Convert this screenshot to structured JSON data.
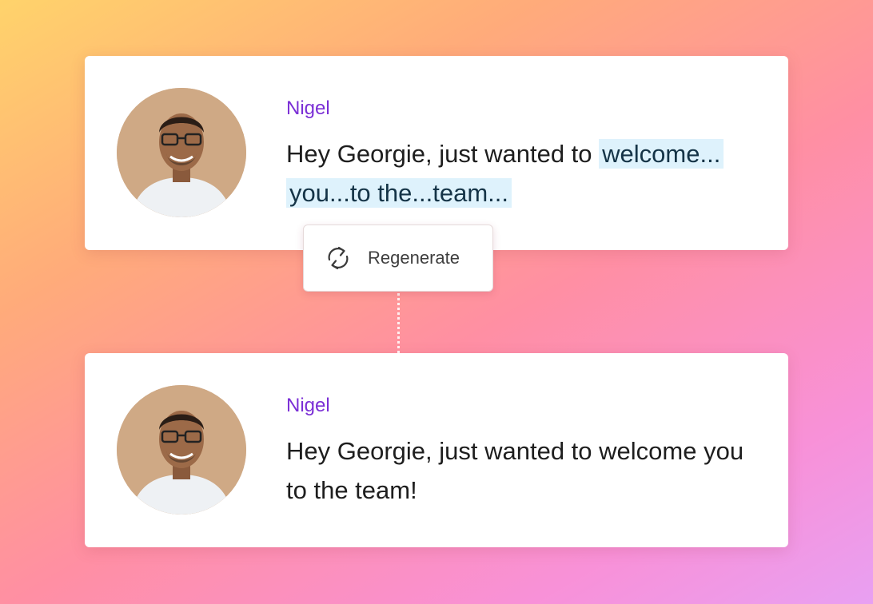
{
  "original_message": {
    "sender": "Nigel",
    "text_plain": "Hey Georgie, just wanted to ",
    "text_highlighted_line1": "welcome...",
    "text_highlighted_line2": "you...to the...team..."
  },
  "regenerate_button": {
    "label": "Regenerate",
    "icon": "refresh-icon"
  },
  "regenerated_message": {
    "sender": "Nigel",
    "text": "Hey Georgie, just wanted to welcome you to the team!"
  },
  "colors": {
    "sender_name": "#7b2fd6",
    "highlight_bg": "#def2fc",
    "background_gradient": [
      "#ffd36b",
      "#ff8fa3",
      "#e8a0f2"
    ]
  }
}
